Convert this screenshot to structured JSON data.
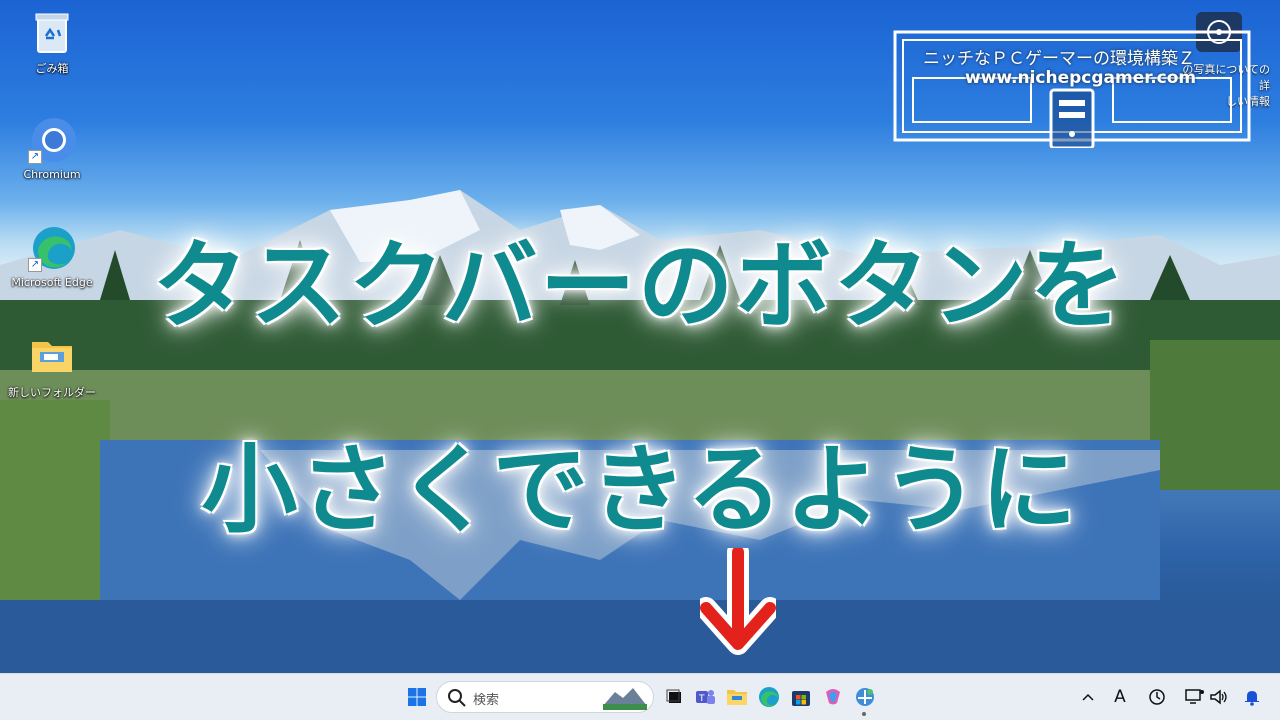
{
  "desktop": {
    "icons": [
      {
        "label": "ごみ箱",
        "icon": "recycle-bin-icon"
      },
      {
        "label": "Chromium",
        "icon": "chromium-icon"
      },
      {
        "label": "Microsoft Edge",
        "icon": "edge-icon"
      },
      {
        "label": "新しいフォルダー",
        "icon": "folder-icon"
      }
    ],
    "corner_label_line1": "の写真についての詳",
    "corner_label_line2": "しい情報"
  },
  "overlay": {
    "title_line1": "タスクバーのボタンを",
    "title_line2": "小さくできるように",
    "arrow_color": "#e3221c",
    "text_color": "#0f8a8e"
  },
  "logo": {
    "line1": "ニッチなＰＣゲーマーの環境構築Ｚ",
    "line2": "www.nichepcgamer.com"
  },
  "taskbar": {
    "search_placeholder": "検索",
    "start_icon": "windows-start-icon",
    "pinned": [
      "task-view-icon",
      "teams-icon",
      "file-explorer-icon",
      "edge-icon",
      "store-icon",
      "copilot-icon",
      "control-panel-icon"
    ],
    "tray": [
      "chevron-up-icon",
      "ime-a-icon",
      "clock-widget-icon",
      "network-icon",
      "volume-icon",
      "notification-bell-icon"
    ],
    "ime_label": "A"
  }
}
